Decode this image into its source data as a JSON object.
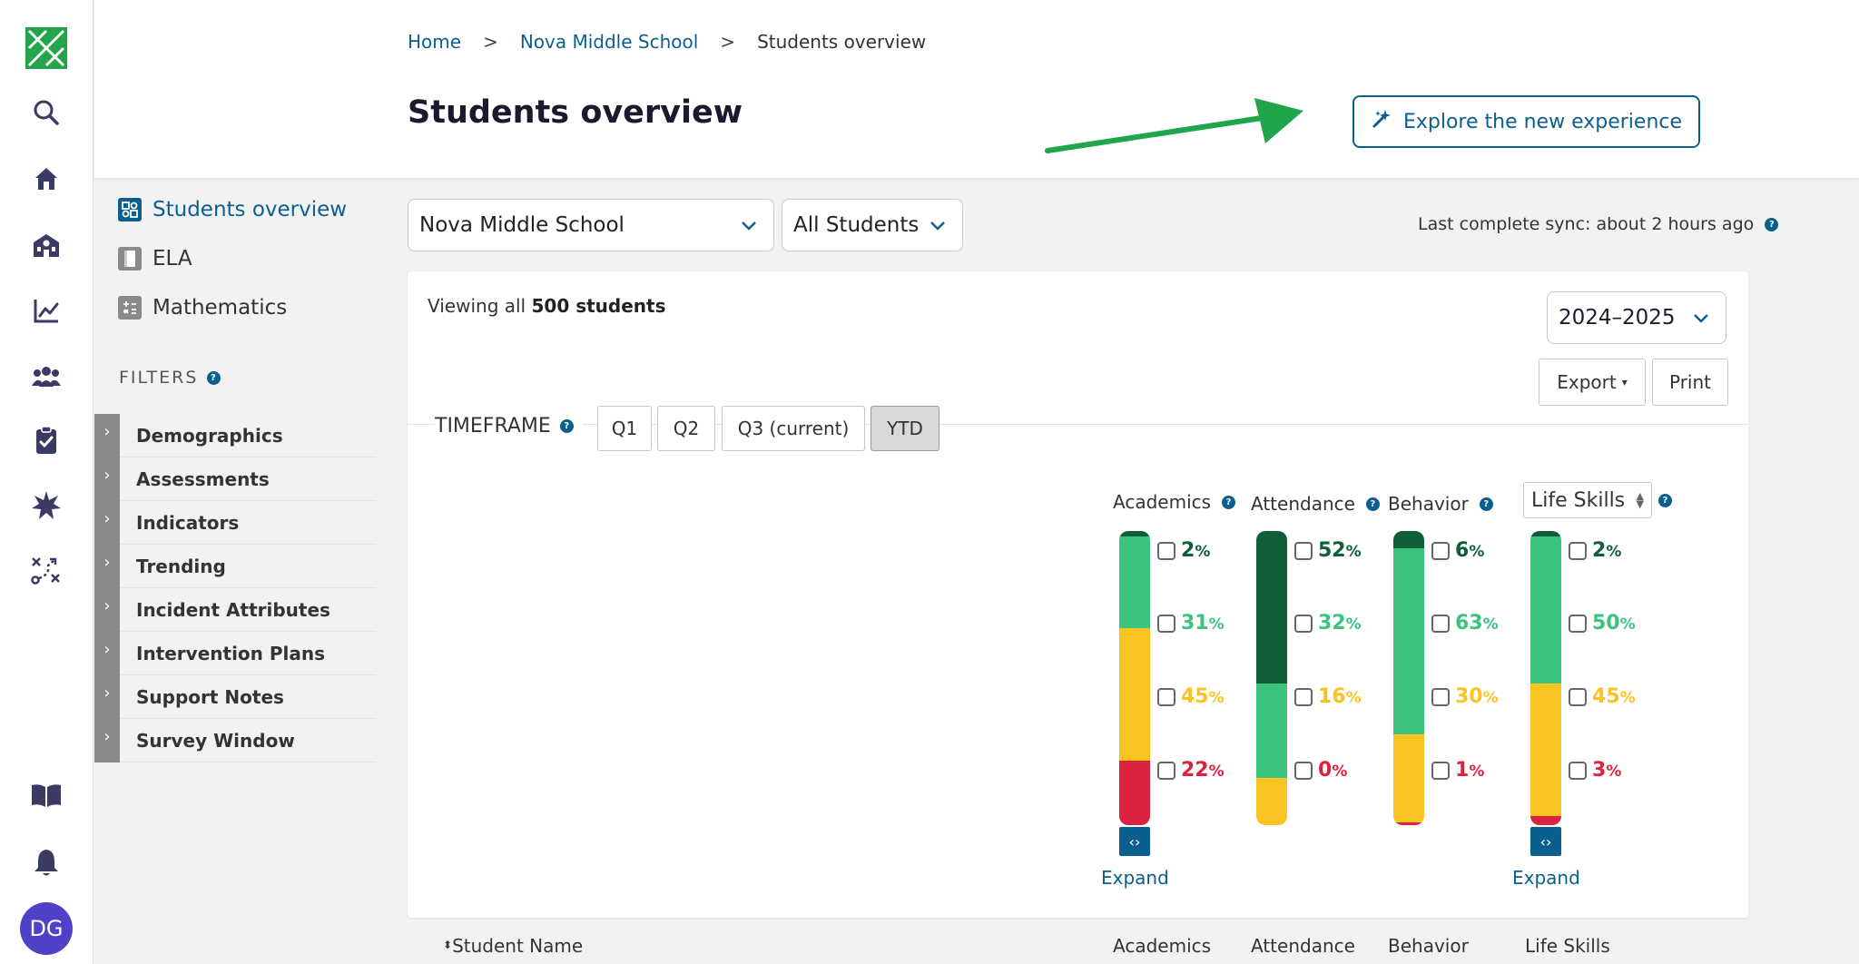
{
  "colors": {
    "accent": "#0b5f8f",
    "dark_green": "#0e5e38",
    "green": "#3cc47f",
    "yellow": "#f9c322",
    "red": "#d9233f",
    "arrow_green": "#1fa64a",
    "avatar": "#4f42c8"
  },
  "rail": {
    "icons": [
      "search-icon",
      "home-icon",
      "school-icon",
      "chart-line-icon",
      "users-icon",
      "clipboard-check-icon",
      "star-badge-icon",
      "strategy-icon",
      "book-icon",
      "bell-icon"
    ],
    "avatar_initials": "DG"
  },
  "breadcrumb": {
    "home": "Home",
    "school": "Nova Middle School",
    "current": "Students overview",
    "sep": ">"
  },
  "page_title": "Students overview",
  "explore_button": "Explore the new experience",
  "subnav": [
    {
      "label": "Students overview",
      "icon": "puzzle-icon"
    },
    {
      "label": "ELA",
      "icon": "book-icon"
    },
    {
      "label": "Mathematics",
      "icon": "calculator-icon"
    }
  ],
  "filters": {
    "title": "FILTERS",
    "items": [
      "Demographics",
      "Assessments",
      "Indicators",
      "Trending",
      "Incident Attributes",
      "Intervention Plans",
      "Support Notes",
      "Survey Window"
    ]
  },
  "school_select": "Nova Middle School",
  "students_select": "All Students",
  "sync_text": "Last complete sync: about 2 hours ago",
  "viewing": {
    "prefix": "Viewing all ",
    "count": "500 students"
  },
  "year_select": "2024–2025",
  "export_label": "Export",
  "print_label": "Print",
  "timeframe": {
    "label": "TIMEFRAME",
    "options": [
      "Q1",
      "Q2",
      "Q3 (current)",
      "YTD"
    ],
    "selected": "YTD"
  },
  "columns": [
    {
      "title": "Academics",
      "values": [
        2,
        31,
        45,
        22
      ],
      "labels": [
        "2",
        "31",
        "45",
        "22"
      ],
      "expand": "Expand"
    },
    {
      "title": "Attendance",
      "values": [
        52,
        32,
        16,
        0
      ],
      "labels": [
        "52",
        "32",
        "16",
        "0"
      ]
    },
    {
      "title": "Behavior",
      "values": [
        6,
        63,
        30,
        1
      ],
      "labels": [
        "6",
        "63",
        "30",
        "1"
      ]
    },
    {
      "title": "Life Skills",
      "values": [
        2,
        50,
        45,
        3
      ],
      "labels": [
        "2",
        "50",
        "45",
        "3"
      ],
      "expand": "Expand"
    }
  ],
  "percent_symbol": "%",
  "table_header": {
    "name": "Student Name",
    "academics": "Academics",
    "attendance": "Attendance",
    "behavior": "Behavior",
    "life_skills": "Life Skills"
  }
}
